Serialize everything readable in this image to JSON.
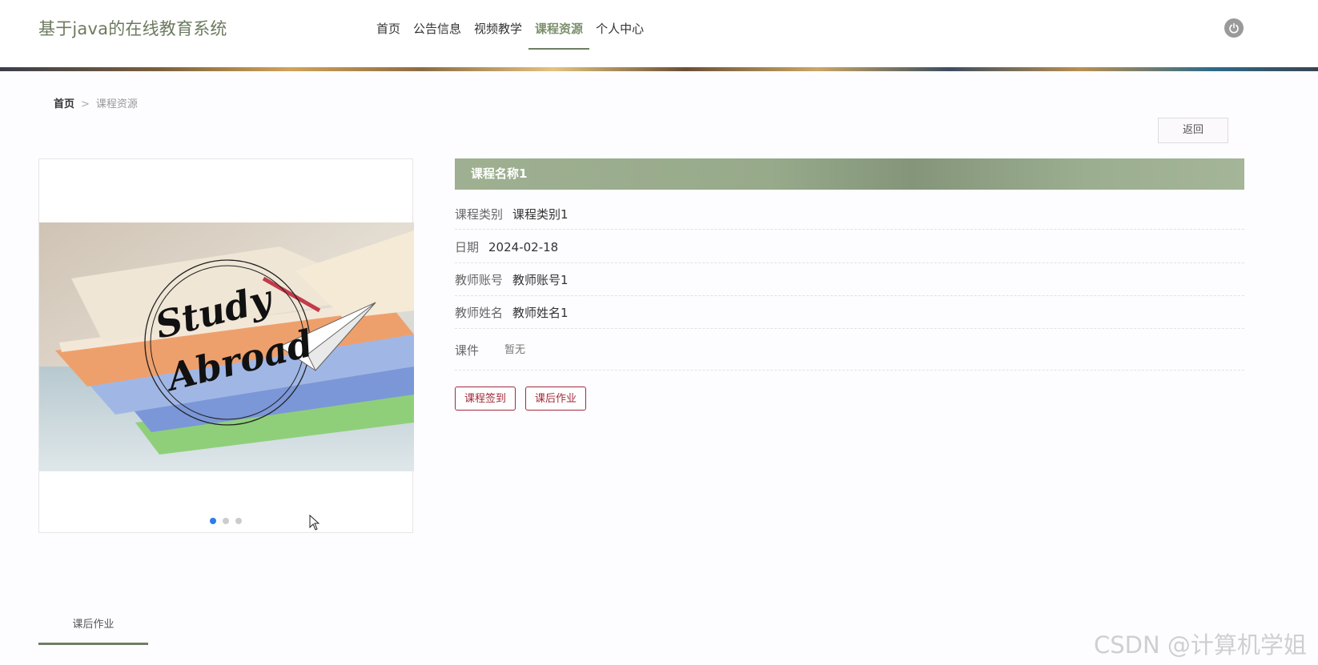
{
  "header": {
    "site_title": "基于java的在线教育系统",
    "nav": [
      {
        "label": "首页",
        "active": false
      },
      {
        "label": "公告信息",
        "active": false
      },
      {
        "label": "视频教学",
        "active": false
      },
      {
        "label": "课程资源",
        "active": true
      },
      {
        "label": "个人中心",
        "active": false
      }
    ],
    "power_icon": "power-icon"
  },
  "breadcrumb": {
    "home": "首页",
    "separator": ">",
    "current": "课程资源"
  },
  "back_button": "返回",
  "carousel": {
    "image_text_line1": "Study",
    "image_text_line2": "Abroad",
    "slide_count": 3,
    "active_index": 0
  },
  "course": {
    "name": "课程名称1",
    "fields": [
      {
        "label": "课程类别",
        "value": "课程类别1"
      },
      {
        "label": "日期",
        "value": "2024-02-18"
      },
      {
        "label": "教师账号",
        "value": "教师账号1"
      },
      {
        "label": "教师姓名",
        "value": "教师姓名1"
      },
      {
        "label": "课件",
        "value": "暂无"
      }
    ]
  },
  "actions": {
    "sign_in": "课程签到",
    "homework": "课后作业"
  },
  "tabs": {
    "homework": "课后作业"
  },
  "watermark": "CSDN @计算机学姐",
  "colors": {
    "accent_green": "#7b8f6b",
    "title_bar": "#97aa8a",
    "action_red": "#a32a3a",
    "dot_active": "#2b7de9"
  }
}
